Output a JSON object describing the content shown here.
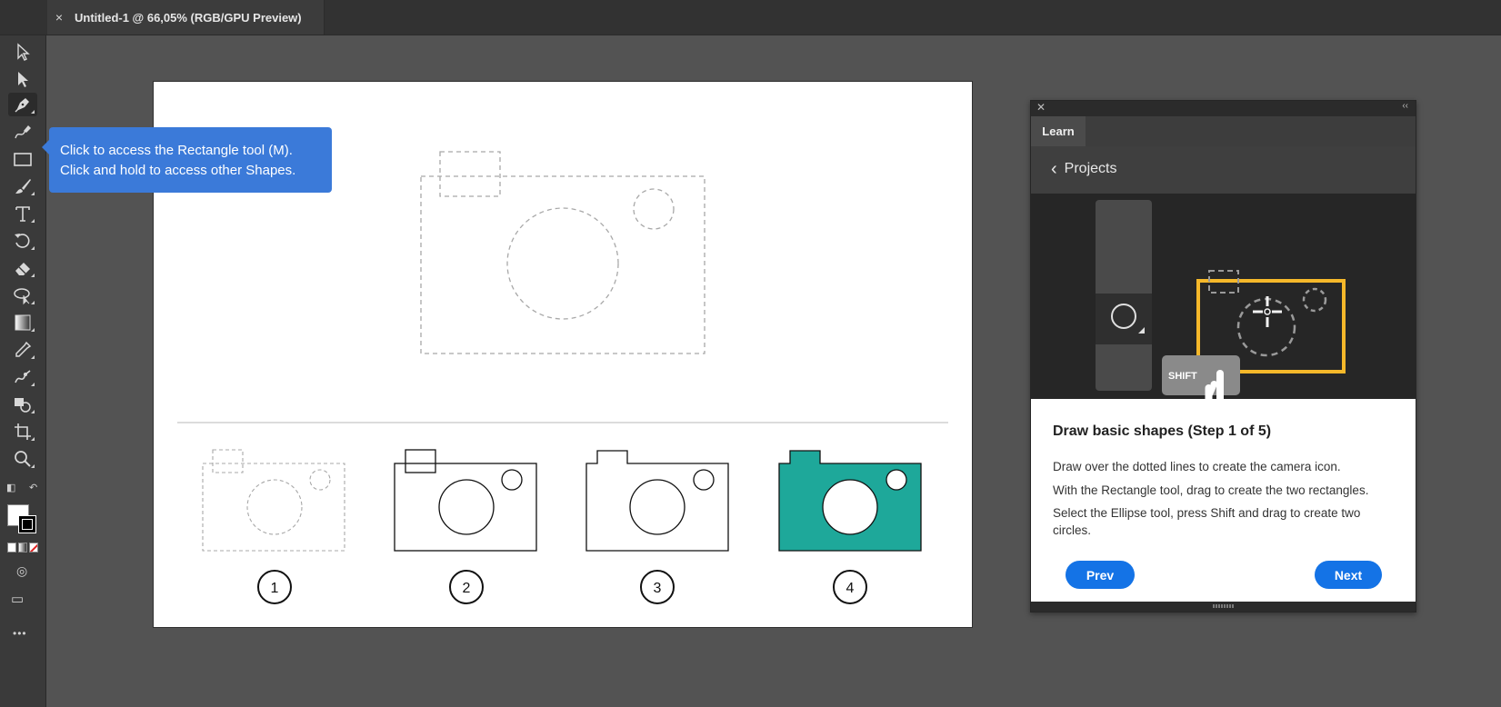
{
  "tab": {
    "close_glyph": "×",
    "title": "Untitled-1 @ 66,05% (RGB/GPU Preview)"
  },
  "tooltip": {
    "line1": "Click to access the Rectangle tool (M).",
    "line2": "Click and hold to access other Shapes."
  },
  "toolbar": {
    "tools": [
      "selection-tool",
      "direct-selection-tool",
      "pen-tool",
      "curvature-tool",
      "rectangle-tool",
      "paintbrush-tool",
      "type-tool",
      "rotate-tool",
      "eraser-tool",
      "lasso-tool",
      "gradient-tool",
      "eyedropper-tool",
      "blend-tool",
      "shape-builder-tool",
      "artboard-tool",
      "zoom-tool"
    ],
    "active_tool": "pen-tool",
    "more_label": "•••"
  },
  "artboard": {
    "step_numbers": [
      "1",
      "2",
      "3",
      "4"
    ],
    "final_fill_color": "#1ea89a"
  },
  "learn_panel": {
    "tab_label": "Learn",
    "back_label": "Projects",
    "shift_key_label": "SHIFT",
    "step_title": "Draw basic shapes (Step 1 of 5)",
    "instructions": [
      "Draw over the dotted lines to create the camera icon.",
      "With the Rectangle tool, drag to create the two rectangles.",
      "Select the Ellipse tool, press Shift and drag to create two circles."
    ],
    "prev_label": "Prev",
    "next_label": "Next",
    "accent_color": "#1473e6",
    "highlight_color": "#f5b82a"
  }
}
